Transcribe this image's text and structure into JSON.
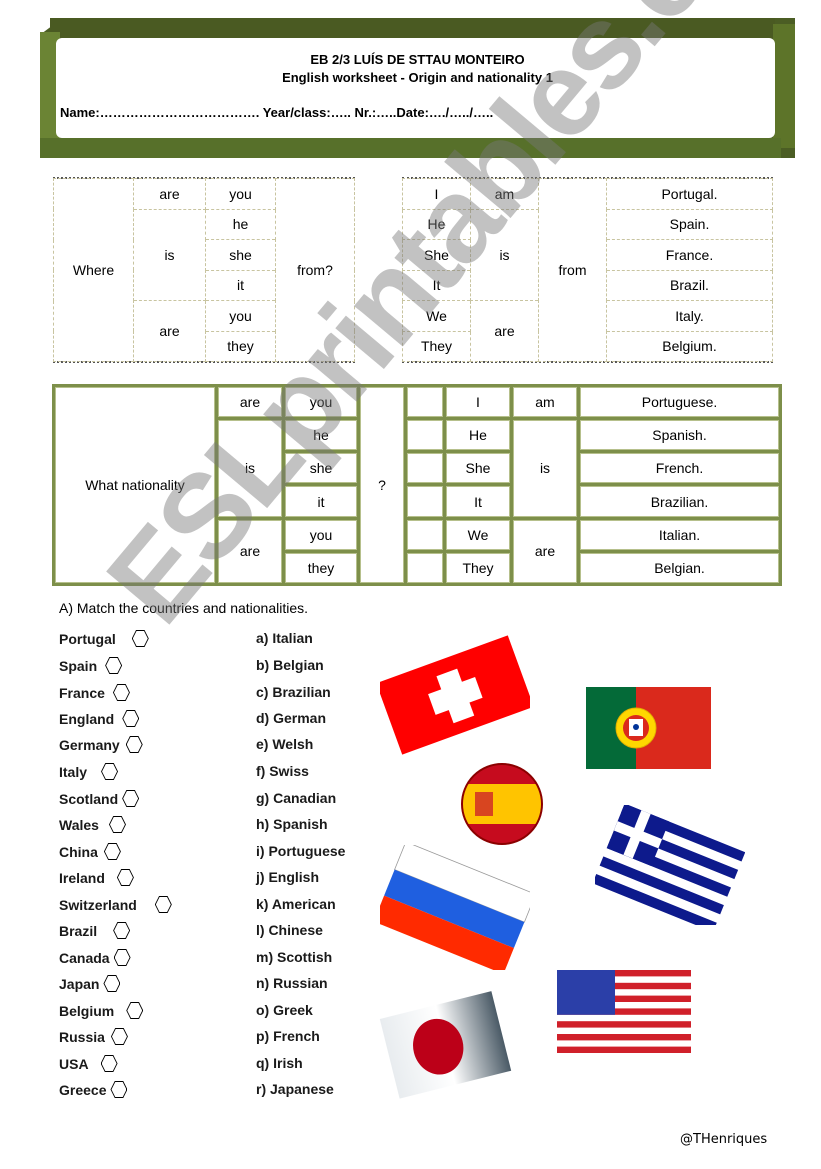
{
  "header": {
    "school": "EB 2/3 LUÍS DE STTAU MONTEIRO",
    "subtitle": "English worksheet - Origin and nationality 1",
    "fields": "Name:………………………………. Year/class:….. Nr.:…..Date:…./…../….."
  },
  "origin_question_table": {
    "col1": "Where",
    "verbs": [
      "are",
      "is",
      "are"
    ],
    "pronouns": [
      "you",
      "he",
      "she",
      "it",
      "you",
      "they"
    ],
    "end": "from?"
  },
  "origin_answer_table": {
    "pronouns": [
      "I",
      "He",
      "She",
      "It",
      "We",
      "They"
    ],
    "verbs": [
      "am",
      "is",
      "are"
    ],
    "middle": "from",
    "countries": [
      "Portugal.",
      "Spain.",
      "France.",
      "Brazil.",
      "Italy.",
      "Belgium."
    ]
  },
  "nationality_table": {
    "col1": "What nationality",
    "verbs": [
      "are",
      "is",
      "are"
    ],
    "pronouns": [
      "you",
      "he",
      "she",
      "it",
      "you",
      "they"
    ],
    "qmark": "?",
    "answer_pronouns": [
      "I",
      "He",
      "She",
      "It",
      "We",
      "They"
    ],
    "answer_verbs": [
      "am",
      "is",
      "are"
    ],
    "nationalities": [
      "Portuguese.",
      "Spanish.",
      "French.",
      "Brazilian.",
      "Italian.",
      "Belgian."
    ]
  },
  "exercise": {
    "instruction": "A)  Match the countries and nationalities.",
    "countries": [
      "Portugal",
      "Spain",
      "France",
      "England",
      "Germany",
      "Italy",
      "Scotland",
      "Wales",
      "China",
      "Ireland",
      "Switzerland",
      "Brazil",
      "Canada",
      "Japan",
      "Belgium",
      "Russia",
      "USA",
      "Greece"
    ],
    "nationalities": [
      "a) Italian",
      "b) Belgian",
      "c) Brazilian",
      "d) German",
      "e) Welsh",
      "f) Swiss",
      "g) Canadian",
      "h) Spanish",
      "i) Portuguese",
      "j) English",
      "k) American",
      "l) Chinese",
      "m) Scottish",
      "n) Russian",
      "o) Greek",
      "p) French",
      "q) Irish",
      "r) Japanese"
    ]
  },
  "flags": [
    "switzerland-flag",
    "portugal-flag",
    "spain-flag",
    "greece-flag",
    "russia-flag",
    "usa-flag",
    "japan-flag"
  ],
  "watermark": "ESLprintables.com",
  "credit": "@THenriques",
  "colors": {
    "banner_green": "#4b5d24",
    "table_green": "#7d8f4a"
  }
}
